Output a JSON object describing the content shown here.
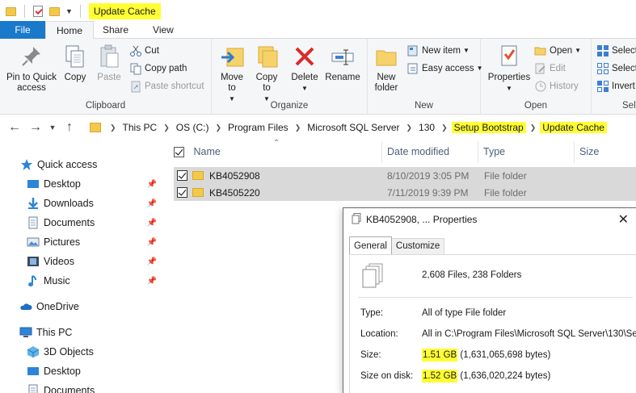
{
  "window": {
    "title": "Update Cache",
    "title_highlight": "#ffff33"
  },
  "tabs": [
    {
      "label": "File"
    },
    {
      "label": "Home"
    },
    {
      "label": "Share"
    },
    {
      "label": "View"
    }
  ],
  "ribbon": {
    "clipboard": {
      "group_label": "Clipboard",
      "pin": "Pin to Quick access",
      "copy": "Copy",
      "paste": "Paste",
      "cut": "Cut",
      "copy_path": "Copy path",
      "paste_shortcut": "Paste shortcut"
    },
    "organize": {
      "group_label": "Organize",
      "move_to": "Move to",
      "copy_to": "Copy to",
      "delete": "Delete",
      "rename": "Rename"
    },
    "new": {
      "group_label": "New",
      "new_folder": "New folder",
      "new_item": "New item",
      "easy_access": "Easy access"
    },
    "open": {
      "group_label": "Open",
      "properties": "Properties",
      "open": "Open",
      "edit": "Edit",
      "history": "History"
    },
    "select": {
      "group_label": "Sele",
      "select_all": "Select",
      "select_none": "Select",
      "invert": "Invert"
    }
  },
  "breadcrumb": [
    {
      "label": "This PC",
      "highlight": false
    },
    {
      "label": "OS (C:)",
      "highlight": false
    },
    {
      "label": "Program Files",
      "highlight": false
    },
    {
      "label": "Microsoft SQL Server",
      "highlight": false
    },
    {
      "label": "130",
      "highlight": false
    },
    {
      "label": "Setup Bootstrap",
      "highlight": true
    },
    {
      "label": "Update Cache",
      "highlight": true
    }
  ],
  "navpane": {
    "quick_access": "Quick access",
    "items": [
      {
        "label": "Desktop",
        "icon": "desktop-icon",
        "pinned": true
      },
      {
        "label": "Downloads",
        "icon": "download-icon",
        "pinned": true
      },
      {
        "label": "Documents",
        "icon": "document-icon",
        "pinned": true
      },
      {
        "label": "Pictures",
        "icon": "pictures-icon",
        "pinned": true
      },
      {
        "label": "Videos",
        "icon": "video-icon",
        "pinned": true
      },
      {
        "label": "Music",
        "icon": "music-icon",
        "pinned": true
      }
    ],
    "onedrive": "OneDrive",
    "this_pc": "This PC",
    "pc_items": [
      {
        "label": "3D Objects",
        "icon": "3d-objects-icon"
      },
      {
        "label": "Desktop",
        "icon": "desktop-icon"
      },
      {
        "label": "Documents",
        "icon": "document-icon"
      }
    ]
  },
  "filelist": {
    "columns": [
      "Name",
      "Date modified",
      "Type",
      "Size"
    ],
    "rows": [
      {
        "name": "KB4052908",
        "date": "8/10/2019 3:05 PM",
        "type": "File folder",
        "checked": true
      },
      {
        "name": "KB4505220",
        "date": "7/11/2019 9:39 PM",
        "type": "File folder",
        "checked": true
      }
    ]
  },
  "dialog": {
    "title": "KB4052908, ... Properties",
    "tabs": [
      "General",
      "Customize"
    ],
    "summary": "2,608 Files, 238 Folders",
    "type_label": "Type:",
    "type_value": "All of type File folder",
    "location_label": "Location:",
    "location_value": "All in C:\\Program Files\\Microsoft SQL Server\\130\\Se",
    "size_label": "Size:",
    "size_value_hl": "1.51 GB",
    "size_value_rest": " (1,631,065,698 bytes)",
    "size_disk_label": "Size on disk:",
    "size_disk_value_hl": "1.52 GB",
    "size_disk_value_rest": " (1,636,020,224 bytes)"
  },
  "colors": {
    "file_tab": "#1979ca",
    "selection": "#d9d9d9",
    "highlight": "#ffff33",
    "folder": "#f3c94b"
  }
}
